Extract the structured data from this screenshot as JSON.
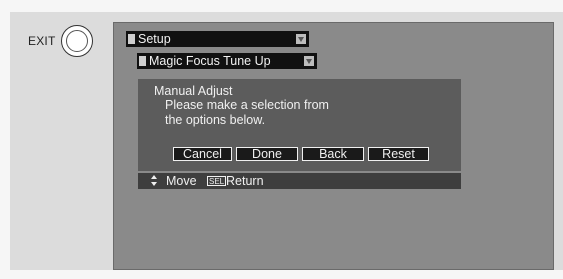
{
  "exit": {
    "label": "EXIT"
  },
  "menu": {
    "setup_title": "Setup",
    "submenu_title": "Magic Focus Tune Up"
  },
  "dialog": {
    "title": "Manual Adjust",
    "message_line1": "Please make a selection from",
    "message_line2": "the options below.",
    "buttons": {
      "cancel": "Cancel",
      "done": "Done",
      "back": "Back",
      "reset": "Reset"
    }
  },
  "footer": {
    "move_label": "Move",
    "sel_key": "SEL",
    "return_label": "Return"
  },
  "icons": {
    "updown": "up-down-arrow-icon",
    "dropdown": "dropdown-arrow-icon",
    "sel": "sel-key-icon"
  },
  "colors": {
    "screen_bg": "#8a8a8a",
    "panel_bg": "#5c5c5c",
    "bar_bg": "#111111",
    "footer_bg": "#3e3e3e"
  }
}
